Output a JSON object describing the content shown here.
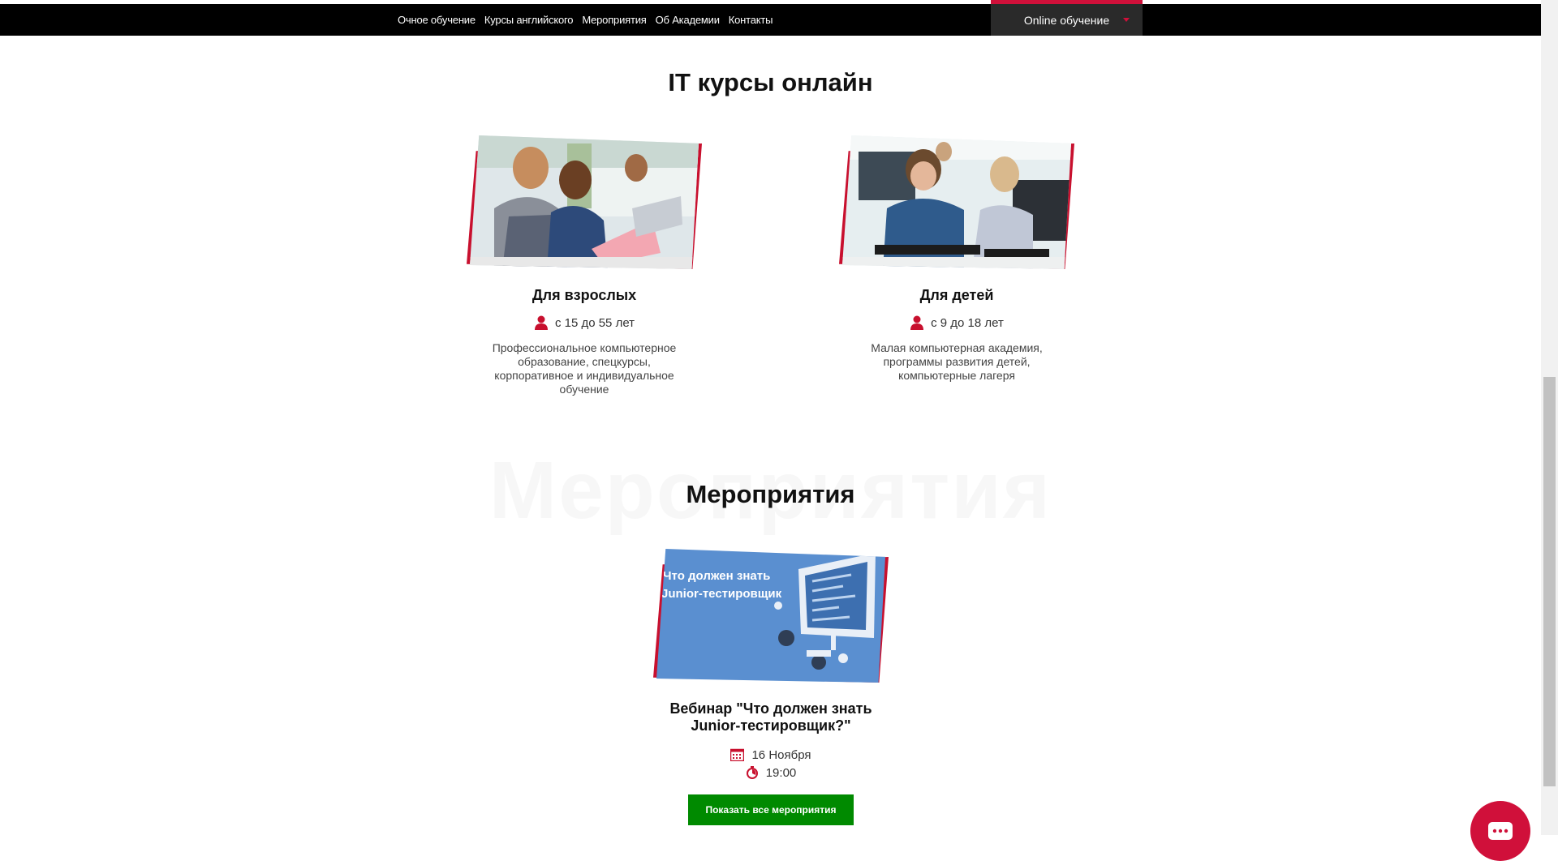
{
  "nav": {
    "links": [
      "Очное обучение",
      "Курсы английского",
      "Мероприятия",
      "Об Академии",
      "Контакты"
    ],
    "online_label": "Online обучение"
  },
  "it_section": {
    "title": "IT курсы онлайн",
    "cards": [
      {
        "title": "Для взрослых",
        "age": "с 15 до 55 лет",
        "description": "Профессиональное компьютерное образование, спецкурсы, корпоративное и индивидуальное обучение"
      },
      {
        "title": "Для детей",
        "age": "с 9 до 18 лет",
        "description": "Малая компьютерная академия, программы развития детей, компьютерные лагеря"
      }
    ]
  },
  "events_section": {
    "ghost_text": "Мероприятия",
    "title": "Мероприятия",
    "event": {
      "image_caption_line1": "Что должен знать",
      "image_caption_line2": "Junior-тестировщик",
      "title": "Вебинар \"Что должен знать Junior-тестировщик?\"",
      "date": "16 Ноября",
      "time": "19:00"
    },
    "show_all_button": "Показать все мероприятия"
  },
  "colors": {
    "accent": "#c8102e",
    "button_green": "#008a00",
    "nav_bg": "#000000"
  }
}
